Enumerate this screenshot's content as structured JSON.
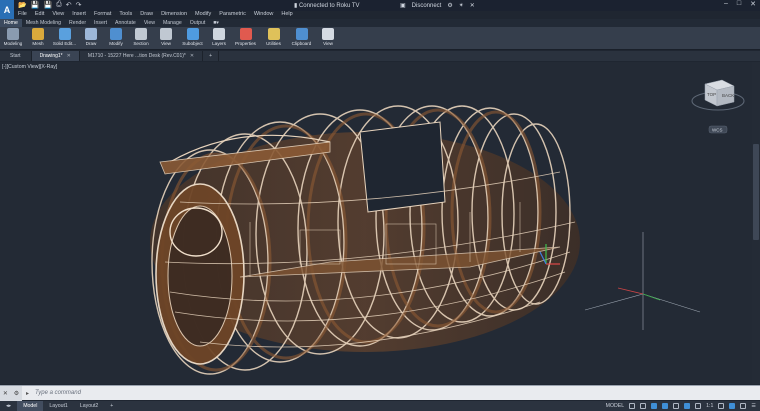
{
  "titlebar": {
    "logo": "A",
    "connection_label": "Connected to Roku TV",
    "disconnect_label": "Disconnect"
  },
  "menu": [
    "File",
    "Edit",
    "View",
    "Insert",
    "Format",
    "Tools",
    "Draw",
    "Dimension",
    "Modify",
    "Parametric",
    "Window",
    "Help"
  ],
  "ribbon_tabs": [
    "Home",
    "Mesh Modeling",
    "Render",
    "Insert",
    "Annotate",
    "View",
    "Manage",
    "Output"
  ],
  "ribbon_buttons": [
    {
      "label": "Modeling",
      "icon": "box-icon",
      "color": "#8a9bb0"
    },
    {
      "label": "Mesh",
      "icon": "sphere-icon",
      "color": "#d9a93c"
    },
    {
      "label": "Solid Edit...",
      "icon": "solid-edit-icon",
      "color": "#5aa0de"
    },
    {
      "label": "Draw",
      "icon": "draw-icon",
      "color": "#9db7d8"
    },
    {
      "label": "Modify",
      "icon": "modify-icon",
      "color": "#4f8fd0"
    },
    {
      "label": "Section",
      "icon": "section-icon",
      "color": "#c0c8d2"
    },
    {
      "label": "View",
      "icon": "view-icon",
      "color": "#c0c8d2"
    },
    {
      "label": "Subobject",
      "icon": "subobject-icon",
      "color": "#4f9be0"
    },
    {
      "label": "Layers",
      "icon": "layers-icon",
      "color": "#cfd6df"
    },
    {
      "label": "Properties",
      "icon": "properties-icon",
      "color": "#e05a4f"
    },
    {
      "label": "Utilities",
      "icon": "utilities-icon",
      "color": "#dfc15a"
    },
    {
      "label": "Clipboard",
      "icon": "clipboard-icon",
      "color": "#4f8fd0"
    },
    {
      "label": "View",
      "icon": "view2-icon",
      "color": "#d5dbe3"
    }
  ],
  "doc_tabs": [
    {
      "label": "Start",
      "active": false
    },
    {
      "label": "Drawing1*",
      "active": true
    },
    {
      "label": "M1710 - 15227 Here ...tion Desk (Rev.C01)*",
      "active": false
    }
  ],
  "viewport": {
    "label": "[-][Custom View][X-Ray]",
    "viewcube_top": "TOP",
    "viewcube_front": "BACK",
    "viewcube_wcs": "WCS",
    "model_color": "#a86a3a",
    "edge_color": "#e6d3bf"
  },
  "command_line": {
    "placeholder": "Type a command"
  },
  "layout_tabs": [
    {
      "label": "Model",
      "active": true
    },
    {
      "label": "Layout1",
      "active": false
    },
    {
      "label": "Layout2",
      "active": false
    }
  ],
  "status": {
    "model_label": "MODEL",
    "scale": "1:1"
  }
}
